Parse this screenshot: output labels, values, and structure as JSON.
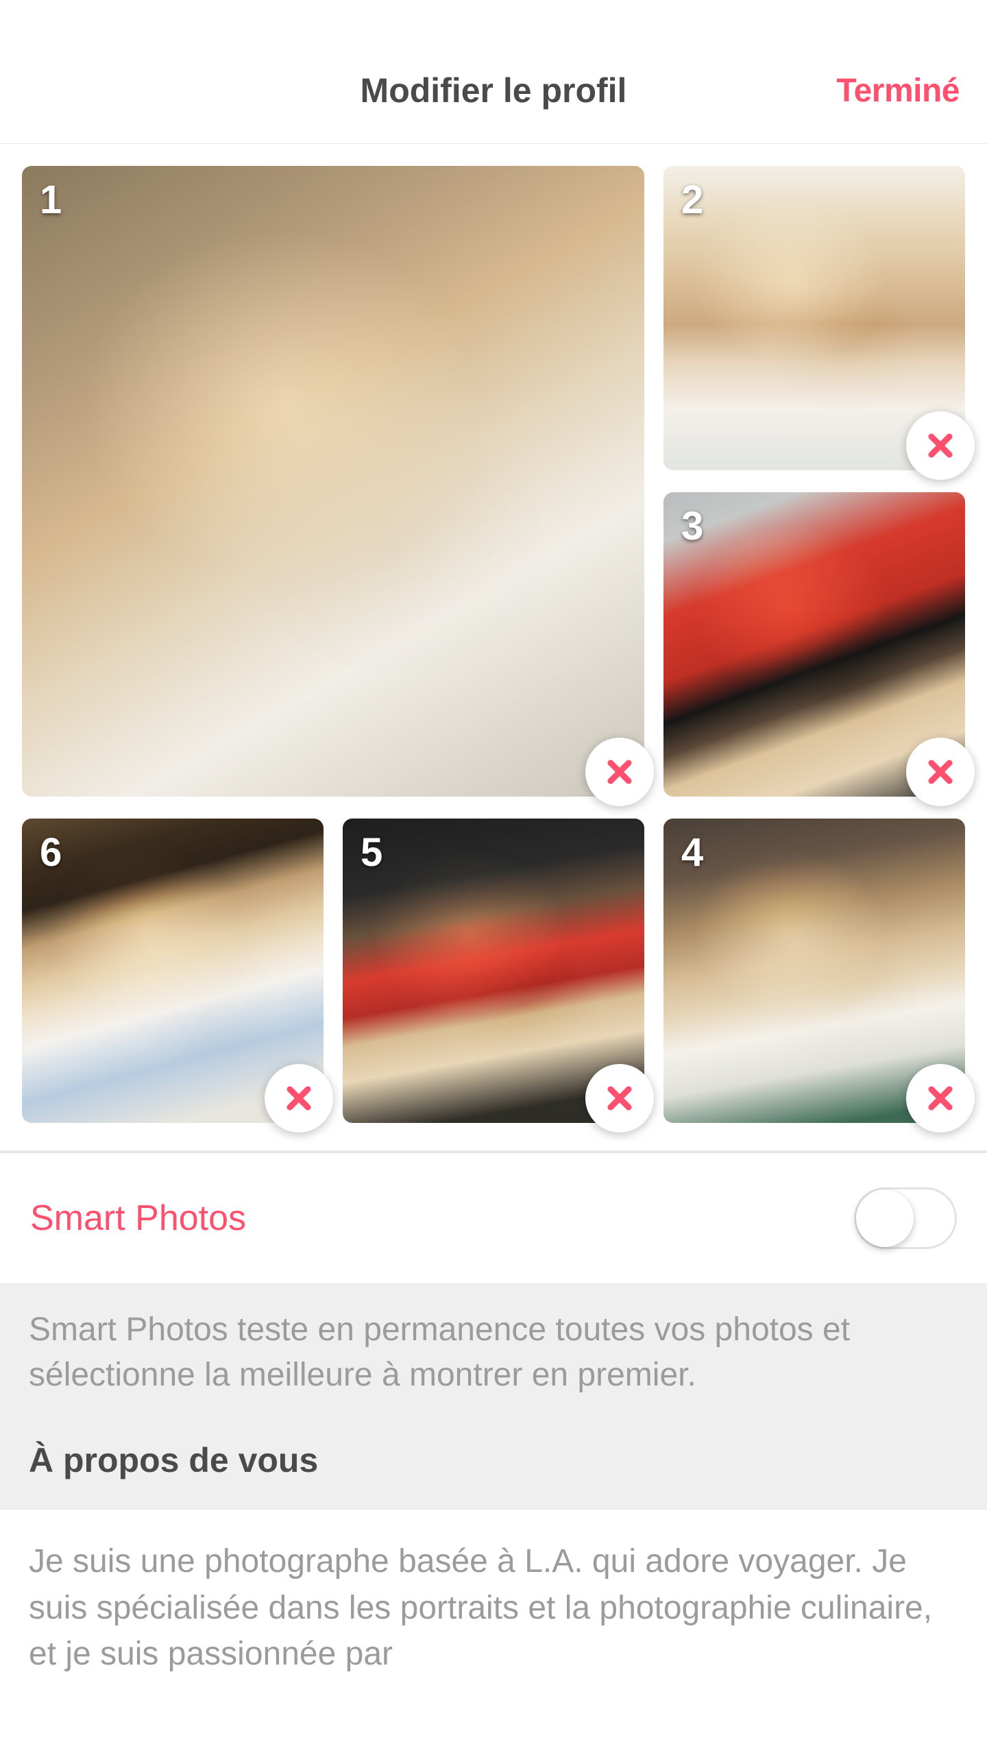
{
  "header": {
    "title": "Modifier le profil",
    "done_label": "Terminé"
  },
  "photos": [
    {
      "order": "1"
    },
    {
      "order": "2"
    },
    {
      "order": "3"
    },
    {
      "order": "4"
    },
    {
      "order": "5"
    },
    {
      "order": "6"
    }
  ],
  "smart_photos": {
    "label": "Smart Photos",
    "enabled": false,
    "description": "Smart Photos teste en permanence toutes vos photos et sélectionne la meilleure à montrer en premier."
  },
  "about": {
    "heading": "À propos de vous",
    "bio": "Je suis une photographe basée à L.A. qui adore voyager. Je suis spécialisée dans les portraits et la photographie culinaire, et je suis passionnée par"
  },
  "colors": {
    "accent": "#fd4f6e"
  }
}
